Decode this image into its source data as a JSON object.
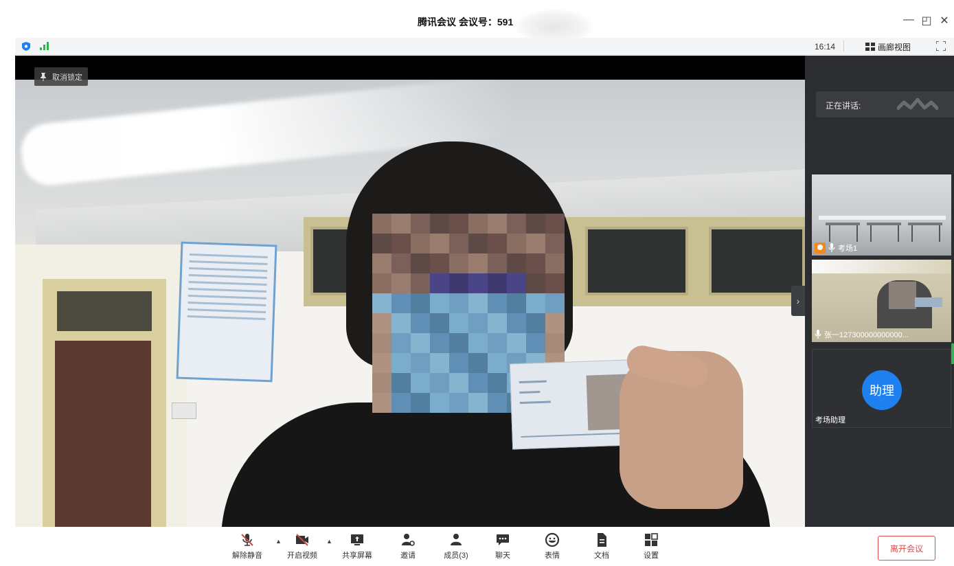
{
  "window": {
    "title": "腾讯会议 会议号：591",
    "minimize": "—",
    "restore": "◰",
    "close": "✕"
  },
  "status": {
    "time": "16:14",
    "gallery_view_label": "画廊视图",
    "encryption_icon": "shield-icon",
    "signal_icon": "signal-bars-icon"
  },
  "video": {
    "unpin_label": "取消锁定",
    "expand_glyph": "›"
  },
  "side_panel": {
    "speaking_label": "正在讲话:",
    "participants": [
      {
        "name": "考场1",
        "icon": "person-icon"
      },
      {
        "name": "张一127300000000000...",
        "icon": "mic-icon"
      },
      {
        "name": "考场助理",
        "avatar_text": "助理"
      }
    ]
  },
  "toolbar": {
    "items": [
      {
        "key": "mute",
        "label": "解除静音",
        "icon": "mic-muted-icon"
      },
      {
        "key": "video",
        "label": "开启视频",
        "icon": "camera-off-icon"
      },
      {
        "key": "share",
        "label": "共享屏幕",
        "icon": "screen-share-icon"
      },
      {
        "key": "invite",
        "label": "邀请",
        "icon": "invite-icon"
      },
      {
        "key": "members",
        "label": "成员(3)",
        "icon": "members-icon"
      },
      {
        "key": "chat",
        "label": "聊天",
        "icon": "chat-icon"
      },
      {
        "key": "reaction",
        "label": "表情",
        "icon": "emoji-icon"
      },
      {
        "key": "docs",
        "label": "文档",
        "icon": "document-icon"
      },
      {
        "key": "settings",
        "label": "设置",
        "icon": "settings-icon"
      }
    ],
    "leave_label": "离开会议"
  },
  "colors": {
    "accent_blue": "#1f80f0",
    "leave_red": "#e04848",
    "panel_bg": "#2b2d30",
    "muted_red": "#e03c3c"
  }
}
